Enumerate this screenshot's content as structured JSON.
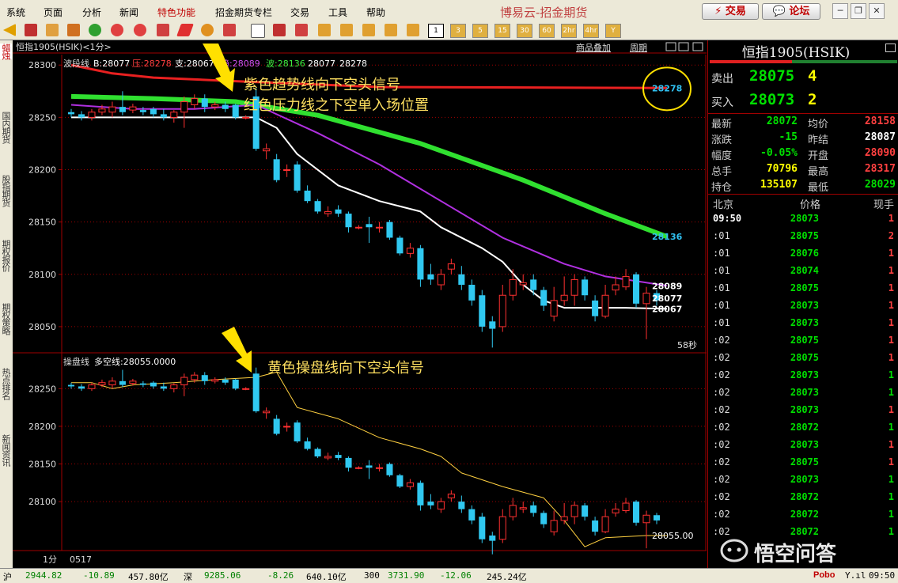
{
  "menu": [
    {
      "label": "系统",
      "accent": false
    },
    {
      "label": "页面",
      "accent": false
    },
    {
      "label": "分析",
      "accent": false
    },
    {
      "label": "新闻",
      "accent": false
    },
    {
      "label": "特色功能",
      "accent": true
    },
    {
      "label": "招金期货专栏",
      "accent": false
    },
    {
      "label": "交易",
      "accent": false
    },
    {
      "label": "工具",
      "accent": false
    },
    {
      "label": "帮助",
      "accent": false
    }
  ],
  "brand": "博易云-招金期货",
  "top_buttons": {
    "trade": "交易",
    "forum": "论坛"
  },
  "period_buttons": [
    "1",
    "3",
    "5",
    "15",
    "30",
    "60",
    "2hr",
    "4hr",
    "Y"
  ],
  "sidebar_tabs": [
    "蜡烛",
    "国内期货",
    "股指期货",
    "期权报价",
    "期权策略",
    "热点排名",
    "新闻资讯"
  ],
  "chart": {
    "header": "恒指1905(HSIK)<1分>",
    "top_legend": {
      "name": "波段线",
      "b": "B:28077",
      "ya": "压:28278",
      "zhi": "支:28067",
      "qu": "趋:28089",
      "bo": "波:28136",
      "v1": "28077",
      "v2": "28278"
    },
    "links": {
      "overlay": "商品叠加",
      "period": "周期"
    },
    "bottom_legend": {
      "name": "操盘线",
      "duo": "多空线:28055.0000"
    },
    "main_yticks": [
      28300,
      28250,
      28200,
      28150,
      28100,
      28050
    ],
    "sub_yticks": [
      28250,
      28200,
      28150,
      28100
    ],
    "labels": {
      "l28278": "28278",
      "l28136": "28136",
      "l28089": "28089",
      "l28077": "28077",
      "l28067": "28067",
      "l28055": "28055.00"
    },
    "countdown": "58秒",
    "annotations": {
      "a1": "紫色趋势线向下空头信号",
      "a2": "红色压力线之下空单入场位置",
      "a3": "黄色操盘线向下空头信号"
    },
    "footer": {
      "period": "1分",
      "date": "0517"
    },
    "colors": {
      "red": "#e82020",
      "green": "#30e030",
      "purple": "#b030e0",
      "white": "#ffffff",
      "yellow": "#ffd040",
      "cyan": "#30c0f0"
    }
  },
  "panel": {
    "title": "恒指1905(HSIK)",
    "sell": {
      "label": "卖出",
      "price": "28075",
      "qty": "4"
    },
    "buy": {
      "label": "买入",
      "price": "28073",
      "qty": "2"
    },
    "quote": [
      {
        "l1": "最新",
        "v1": "28072",
        "c1": "#00e000",
        "l2": "均价",
        "v2": "28158",
        "c2": "#ff4040"
      },
      {
        "l1": "涨跌",
        "v1": "-15",
        "c1": "#00e000",
        "l2": "昨结",
        "v2": "28087",
        "c2": "#ffffff"
      },
      {
        "l1": "幅度",
        "v1": "-0.05%",
        "c1": "#00e000",
        "l2": "开盘",
        "v2": "28090",
        "c2": "#ff4040"
      },
      {
        "l1": "总手",
        "v1": "70796",
        "c1": "#ffff00",
        "l2": "最高",
        "v2": "28317",
        "c2": "#ff4040"
      },
      {
        "l1": "持仓",
        "v1": "135107",
        "c1": "#ffff00",
        "l2": "最低",
        "v2": "28029",
        "c2": "#00e000"
      }
    ],
    "ticks_header": {
      "place": "北京",
      "price": "价格",
      "vol": "现手"
    },
    "ticks": [
      {
        "t": "09:50",
        "p": "28073",
        "v": "1",
        "c": "#ff4040"
      },
      {
        "t": ":01",
        "p": "28075",
        "v": "2",
        "c": "#ff4040"
      },
      {
        "t": ":01",
        "p": "28076",
        "v": "1",
        "c": "#ff4040"
      },
      {
        "t": ":01",
        "p": "28074",
        "v": "1",
        "c": "#ff4040"
      },
      {
        "t": ":01",
        "p": "28075",
        "v": "1",
        "c": "#ff4040"
      },
      {
        "t": ":01",
        "p": "28073",
        "v": "1",
        "c": "#ff4040"
      },
      {
        "t": ":01",
        "p": "28073",
        "v": "1",
        "c": "#ff4040"
      },
      {
        "t": ":02",
        "p": "28075",
        "v": "1",
        "c": "#ff4040"
      },
      {
        "t": ":02",
        "p": "28075",
        "v": "1",
        "c": "#ff4040"
      },
      {
        "t": ":02",
        "p": "28073",
        "v": "1",
        "c": "#00e000"
      },
      {
        "t": ":02",
        "p": "28073",
        "v": "1",
        "c": "#00e000"
      },
      {
        "t": ":02",
        "p": "28073",
        "v": "1",
        "c": "#ff4040"
      },
      {
        "t": ":02",
        "p": "28072",
        "v": "1",
        "c": "#00e000"
      },
      {
        "t": ":02",
        "p": "28073",
        "v": "1",
        "c": "#ff4040"
      },
      {
        "t": ":02",
        "p": "28075",
        "v": "1",
        "c": "#ff4040"
      },
      {
        "t": ":02",
        "p": "28073",
        "v": "1",
        "c": "#00e000"
      },
      {
        "t": ":02",
        "p": "28072",
        "v": "1",
        "c": "#00e000"
      },
      {
        "t": ":02",
        "p": "28072",
        "v": "1",
        "c": "#00e000"
      },
      {
        "t": ":02",
        "p": "28072",
        "v": "1",
        "c": "#00e000"
      }
    ]
  },
  "status": {
    "hu_label": "沪",
    "hu_val": "2944.82",
    "hu_chg": "-10.89",
    "hu_amt": "457.80亿",
    "shen_label": "深",
    "shen_val": "9285.06",
    "shen_chg": "-8.26",
    "shen_amt": "640.10亿",
    "idx_label": "300",
    "idx_val": "3731.90",
    "idx_chg": "-12.06",
    "idx_amt": "245.24亿",
    "brand": "Pobo",
    "clock": "09:50"
  },
  "watermark": "悟空问答",
  "chart_data": {
    "type": "candlestick",
    "main_ylim": [
      28025,
      28310
    ],
    "sub_ylim": [
      28035,
      28285
    ],
    "candles": [
      [
        28255,
        28253,
        28258,
        28250
      ],
      [
        28253,
        28250,
        28256,
        28247
      ],
      [
        28250,
        28255,
        28258,
        28247
      ],
      [
        28255,
        28258,
        28262,
        28252
      ],
      [
        28255,
        28260,
        28265,
        28250
      ],
      [
        28260,
        28255,
        28275,
        28252
      ],
      [
        28257,
        28260,
        28263,
        28254
      ],
      [
        28257,
        28255,
        28260,
        28252
      ],
      [
        28258,
        28253,
        28260,
        28250
      ],
      [
        28253,
        28250,
        28258,
        28247
      ],
      [
        28250,
        28255,
        28257,
        28245
      ],
      [
        28255,
        28265,
        28270,
        28240
      ],
      [
        28262,
        28268,
        28272,
        28258
      ],
      [
        28268,
        28260,
        28272,
        28255
      ],
      [
        28260,
        28262,
        28265,
        28257
      ],
      [
        28262,
        28258,
        28265,
        28255
      ],
      [
        28262,
        28250,
        28263,
        28248
      ],
      [
        28250,
        28250,
        28252,
        28248
      ],
      [
        28270,
        28220,
        28278,
        28218
      ],
      [
        28218,
        28220,
        28225,
        28210
      ],
      [
        28210,
        28190,
        28215,
        28188
      ],
      [
        28200,
        28200,
        28205,
        28193
      ],
      [
        28205,
        28180,
        28208,
        28178
      ],
      [
        28180,
        28170,
        28185,
        28168
      ],
      [
        28170,
        28160,
        28172,
        28158
      ],
      [
        28158,
        28160,
        28165,
        28155
      ],
      [
        28162,
        28158,
        28166,
        28155
      ],
      [
        28158,
        28145,
        28160,
        28140
      ],
      [
        28145,
        28145,
        28147,
        28143
      ],
      [
        28148,
        28145,
        28155,
        28130
      ],
      [
        28145,
        28145,
        28150,
        28140
      ],
      [
        28150,
        28135,
        28152,
        28133
      ],
      [
        28135,
        28120,
        28137,
        28118
      ],
      [
        28120,
        28125,
        28130,
        28116
      ],
      [
        28125,
        28095,
        28128,
        28088
      ],
      [
        28100,
        28095,
        28110,
        28090
      ],
      [
        28090,
        28100,
        28105,
        28085
      ],
      [
        28105,
        28110,
        28115,
        28100
      ],
      [
        28100,
        28090,
        28108,
        28085
      ],
      [
        28090,
        28075,
        28095,
        28070
      ],
      [
        28080,
        28050,
        28085,
        28045
      ],
      [
        28055,
        28048,
        28060,
        28030
      ],
      [
        28050,
        28080,
        28090,
        28045
      ],
      [
        28080,
        28095,
        28105,
        28075
      ],
      [
        28090,
        28092,
        28100,
        28085
      ],
      [
        28095,
        28085,
        28100,
        28080
      ],
      [
        28085,
        28070,
        28088,
        28065
      ],
      [
        28060,
        28075,
        28088,
        28055
      ],
      [
        28075,
        28080,
        28098,
        28070
      ],
      [
        28080,
        28095,
        28100,
        28070
      ],
      [
        28095,
        28080,
        28098,
        28075
      ],
      [
        28075,
        28060,
        28080,
        28055
      ],
      [
        28060,
        28080,
        28090,
        28058
      ],
      [
        28085,
        28090,
        28098,
        28080
      ],
      [
        28088,
        28098,
        28105,
        28085
      ],
      [
        28100,
        28072,
        28102,
        28068
      ],
      [
        28072,
        28082,
        28088,
        28038
      ],
      [
        28082,
        28075,
        28085,
        28070
      ]
    ],
    "lines": [
      {
        "name": "压",
        "color": "#e82020",
        "values": [
          [
            0,
            28300
          ],
          [
            4,
            28292
          ],
          [
            8,
            28288
          ],
          [
            15,
            28285
          ],
          [
            30,
            28279
          ],
          [
            58,
            28278
          ]
        ]
      },
      {
        "name": "波",
        "color": "#30e030",
        "values": [
          [
            0,
            28270
          ],
          [
            8,
            28268
          ],
          [
            16,
            28265
          ],
          [
            24,
            28252
          ],
          [
            34,
            28225
          ],
          [
            44,
            28190
          ],
          [
            52,
            28158
          ],
          [
            58,
            28136
          ]
        ]
      },
      {
        "name": "趋",
        "color": "#b030e0",
        "values": [
          [
            0,
            28262
          ],
          [
            6,
            28258
          ],
          [
            12,
            28258
          ],
          [
            18,
            28262
          ],
          [
            24,
            28235
          ],
          [
            30,
            28205
          ],
          [
            36,
            28170
          ],
          [
            42,
            28135
          ],
          [
            48,
            28110
          ],
          [
            52,
            28098
          ],
          [
            58,
            28089
          ]
        ]
      },
      {
        "name": "支",
        "color": "#ffffff",
        "values": [
          [
            0,
            28250
          ],
          [
            6,
            28250
          ],
          [
            12,
            28250
          ],
          [
            18,
            28250
          ],
          [
            20,
            28240
          ],
          [
            22,
            28215
          ],
          [
            26,
            28185
          ],
          [
            30,
            28170
          ],
          [
            34,
            28160
          ],
          [
            36,
            28145
          ],
          [
            40,
            28125
          ],
          [
            42,
            28112
          ],
          [
            44,
            28090
          ],
          [
            46,
            28075
          ],
          [
            48,
            28068
          ],
          [
            54,
            28068
          ],
          [
            58,
            28067
          ]
        ]
      }
    ],
    "sub_line": {
      "name": "多空线",
      "color": "#ffd040",
      "values": [
        [
          0,
          28258
        ],
        [
          2,
          28258
        ],
        [
          4,
          28250
        ],
        [
          6,
          28255
        ],
        [
          10,
          28258
        ],
        [
          14,
          28262
        ],
        [
          18,
          28265
        ],
        [
          20,
          28272
        ],
        [
          22,
          28225
        ],
        [
          26,
          28210
        ],
        [
          30,
          28185
        ],
        [
          34,
          28170
        ],
        [
          36,
          28160
        ],
        [
          38,
          28138
        ],
        [
          42,
          28120
        ],
        [
          46,
          28105
        ],
        [
          48,
          28075
        ],
        [
          50,
          28040
        ],
        [
          52,
          28052
        ],
        [
          56,
          28055
        ],
        [
          58,
          28055
        ]
      ]
    }
  }
}
